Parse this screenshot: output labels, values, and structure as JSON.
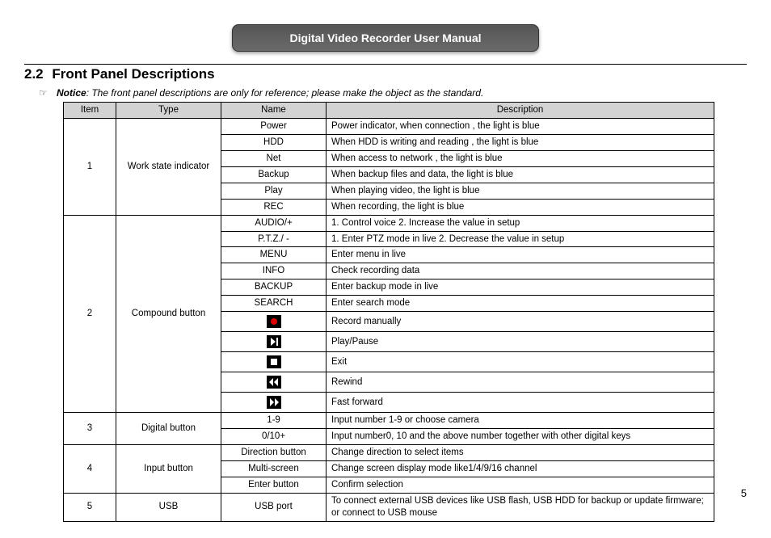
{
  "header": {
    "title": "Digital Video Recorder User Manual"
  },
  "section": {
    "number": "2.2",
    "title": "Front Panel Descriptions"
  },
  "notice": {
    "label": "Notice",
    "text": ": The front panel descriptions are only for reference; please make the object as the standard."
  },
  "table": {
    "cols": [
      "Item",
      "Type",
      "Name",
      "Description"
    ],
    "groups": [
      {
        "item": "1",
        "type": "Work state indicator",
        "rows": [
          {
            "name": "Power",
            "desc": "Power indicator, when connection , the light is blue"
          },
          {
            "name": "HDD",
            "desc": "When HDD is writing and reading , the light is blue"
          },
          {
            "name": "Net",
            "desc": "When access to network , the light is blue"
          },
          {
            "name": "Backup",
            "desc": "When backup files and data,    the light is blue"
          },
          {
            "name": "Play",
            "desc": "When playing video,    the light is blue"
          },
          {
            "name": "REC",
            "desc": "When recording,    the light is blue"
          }
        ]
      },
      {
        "item": "2",
        "type": "Compound button",
        "rows": [
          {
            "name": "AUDIO/+",
            "desc": "1. Control voice      2. Increase the value in setup"
          },
          {
            "name": "P.T.Z./ -",
            "desc": "1. Enter PTZ mode in live    2. Decrease the value in setup"
          },
          {
            "name": "MENU",
            "desc": "Enter menu in live"
          },
          {
            "name": "INFO",
            "desc": "Check recording data"
          },
          {
            "name": "BACKUP",
            "desc": "Enter backup mode in live"
          },
          {
            "name": "SEARCH",
            "desc": "Enter search mode"
          },
          {
            "icon": "icon-rec",
            "desc": "Record manually"
          },
          {
            "icon": "icon-play",
            "desc": "Play/Pause"
          },
          {
            "icon": "icon-stop",
            "desc": "Exit"
          },
          {
            "icon": "icon-rew",
            "desc": "Rewind"
          },
          {
            "icon": "icon-ffw",
            "desc": "Fast forward"
          }
        ]
      },
      {
        "item": "3",
        "type": "Digital button",
        "rows": [
          {
            "name": "1-9",
            "desc": "Input number 1-9 or choose camera"
          },
          {
            "name": "0/10+",
            "desc": "Input number0, 10 and the above number together with other digital keys"
          }
        ]
      },
      {
        "item": "4",
        "type": "Input button",
        "rows": [
          {
            "name": "Direction button",
            "desc": "Change direction to select items"
          },
          {
            "name": "Multi-screen",
            "desc": "Change screen display mode like1/4/9/16 channel"
          },
          {
            "name": "Enter button",
            "desc": "Confirm selection"
          }
        ]
      },
      {
        "item": "5",
        "type": "USB",
        "rows": [
          {
            "name": "USB port",
            "desc": "To connect external USB devices like USB flash, USB HDD for backup or update firmware; or connect to USB mouse"
          }
        ]
      }
    ]
  },
  "page": "5"
}
